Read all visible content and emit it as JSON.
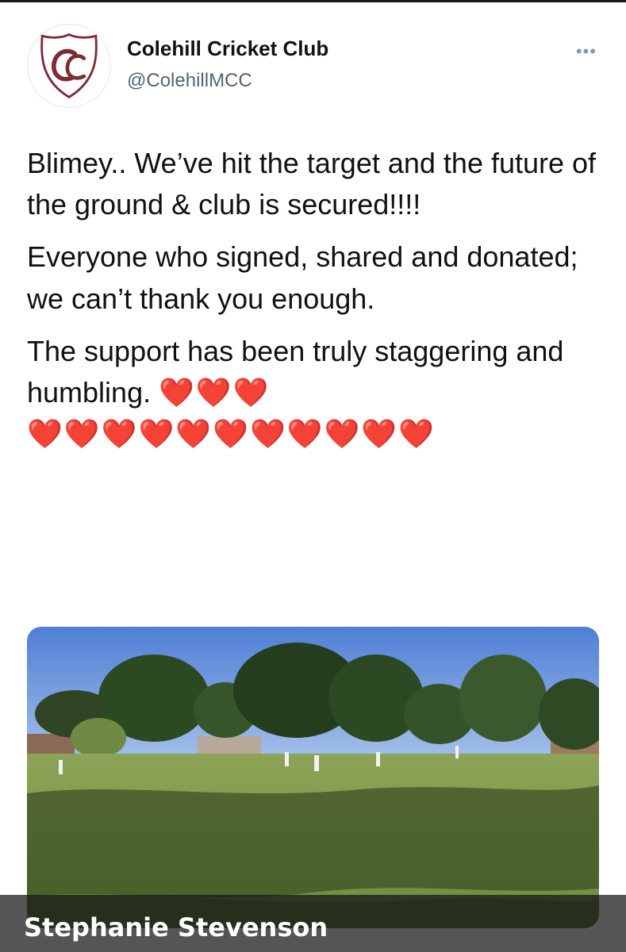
{
  "account": {
    "name": "Colehill Cricket Club",
    "handle": "@ColehillMCC",
    "avatar_icon": "cc-crest-icon",
    "avatar_letters": "CC",
    "crest_color": "#7b2d33"
  },
  "menu": {
    "more_label": "•••"
  },
  "tweet": {
    "paragraphs": [
      "Blimey.. We’ve hit the target and the future of the ground & club is secured!!!!",
      "Everyone who signed, shared and donated; we can’t thank you enough.",
      "The support has been truly staggering and humbling."
    ],
    "hearts_inline": "❤️❤️❤️",
    "hearts_line": "❤️❤️❤️❤️❤️❤️❤️❤️❤️❤️❤️"
  },
  "media": {
    "subject": "cricket-ground-photo"
  },
  "overlay": {
    "name": "Stephanie Stevenson"
  }
}
